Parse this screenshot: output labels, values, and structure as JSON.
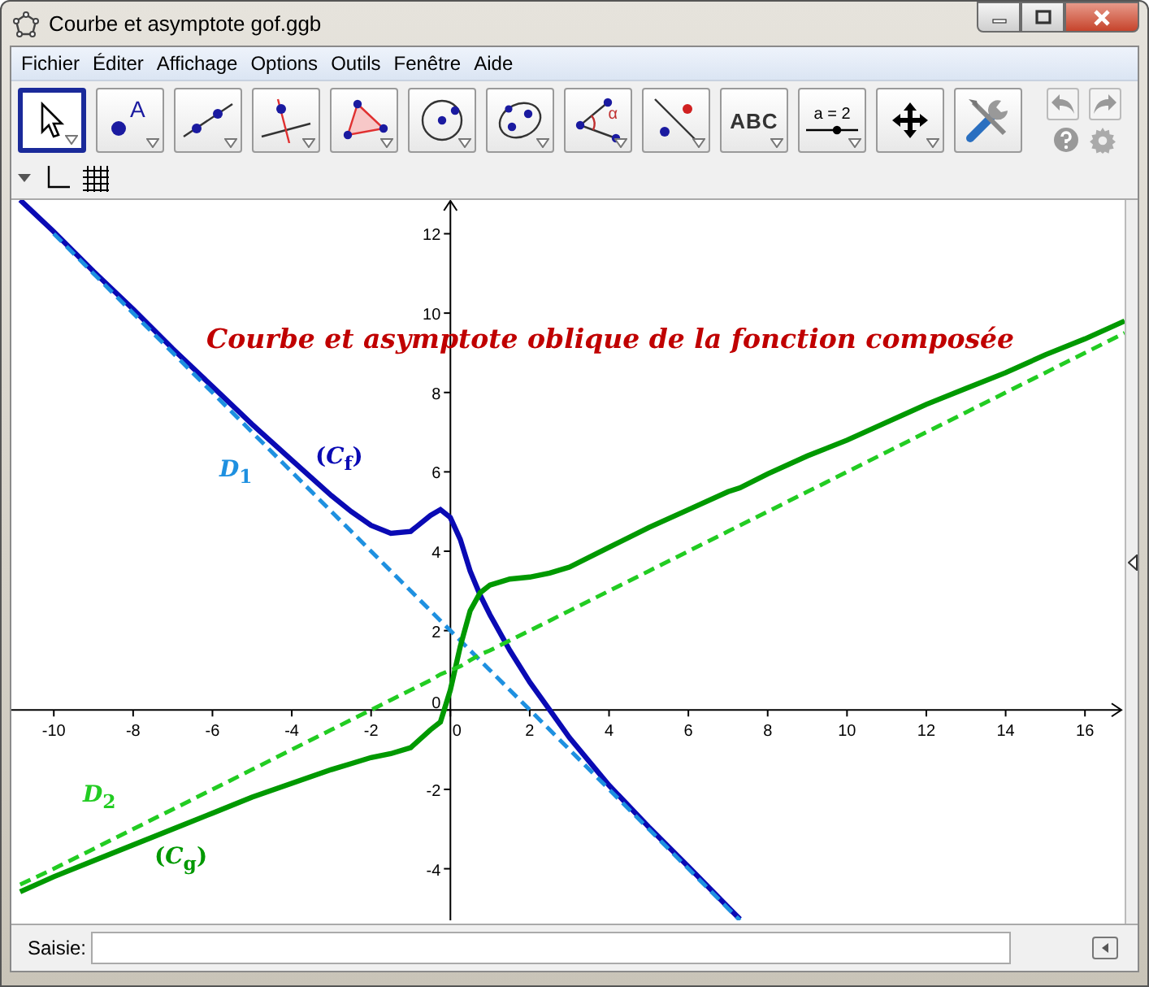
{
  "window": {
    "title": "Courbe et asymptote gof.ggb"
  },
  "menu": [
    "Fichier",
    "Éditer",
    "Affichage",
    "Options",
    "Outils",
    "Fenêtre",
    "Aide"
  ],
  "toolbar": [
    {
      "kind": "move",
      "selected": true
    },
    {
      "kind": "point",
      "label": "A",
      "selected": false
    },
    {
      "kind": "line",
      "selected": false
    },
    {
      "kind": "perpendicular",
      "selected": false
    },
    {
      "kind": "polygon",
      "selected": false
    },
    {
      "kind": "circle",
      "selected": false
    },
    {
      "kind": "conic",
      "selected": false
    },
    {
      "kind": "angle",
      "label": "α",
      "selected": false
    },
    {
      "kind": "reflect",
      "selected": false
    },
    {
      "kind": "text",
      "label": "ABC",
      "selected": false
    },
    {
      "kind": "slider",
      "label": "a = 2",
      "selected": false
    },
    {
      "kind": "pan",
      "selected": false
    },
    {
      "kind": "tools",
      "selected": false
    }
  ],
  "graphics": {
    "chart_data": {
      "type": "line",
      "title": "Courbe et asymptote oblique de la fonction composée",
      "x": [
        -10.85,
        -10,
        -9,
        -8,
        -7,
        -6,
        -5,
        -4,
        -3,
        -2.5,
        -2,
        -1.5,
        -1,
        -0.5,
        -0.25,
        0,
        0.25,
        0.5,
        0.75,
        1,
        1.5,
        2,
        2.5,
        3,
        4,
        5,
        6,
        7,
        7.3,
        8,
        9,
        10,
        11,
        12,
        13,
        14,
        15,
        16,
        17
      ],
      "series": [
        {
          "name": "(*C*$_{f}$)",
          "color": "#0a0ab4",
          "line_style": "solid",
          "values": [
            12.85,
            12.05,
            11.05,
            10.1,
            9.1,
            8.15,
            7.2,
            6.3,
            5.4,
            5.0,
            4.65,
            4.45,
            4.5,
            4.9,
            5.05,
            4.85,
            4.3,
            3.5,
            2.9,
            2.4,
            1.5,
            0.7,
            0,
            -0.7,
            -1.9,
            -2.95,
            -3.95,
            -4.97,
            -5.27,
            null,
            null,
            null,
            null,
            null,
            null,
            null,
            null,
            null,
            null
          ]
        },
        {
          "name": "*D*$_{1}$",
          "color": "#1e90e0",
          "line_style": "dashed",
          "values": [
            null,
            12,
            11,
            10,
            9,
            8,
            7,
            6,
            5,
            4.5,
            4,
            3.5,
            3,
            2.5,
            2.25,
            2,
            1.75,
            1.5,
            1.25,
            1,
            0.5,
            0,
            -0.5,
            -1,
            -2,
            -3,
            -4,
            -5,
            -5.3,
            null,
            null,
            null,
            null,
            null,
            null,
            null,
            null,
            null,
            null
          ]
        },
        {
          "name": "(*C*$_{g}$)",
          "color": "#009900",
          "line_style": "solid",
          "values": [
            -4.58,
            -4.2,
            -3.8,
            -3.4,
            -3.0,
            -2.6,
            -2.2,
            -1.85,
            -1.5,
            -1.35,
            -1.2,
            -1.1,
            -0.95,
            -0.5,
            -0.3,
            0.5,
            1.6,
            2.5,
            2.95,
            3.15,
            3.3,
            3.35,
            3.45,
            3.6,
            4.1,
            4.6,
            5.05,
            5.5,
            5.6,
            5.95,
            6.4,
            6.8,
            7.25,
            7.7,
            8.1,
            8.5,
            8.95,
            9.35,
            9.8
          ]
        },
        {
          "name": "*D*$_{2}$",
          "color": "#22cc22",
          "line_style": "dashed",
          "values": [
            -4.4,
            -4,
            -3.5,
            -3,
            -2.5,
            -2,
            -1.5,
            -1,
            -0.5,
            -0.25,
            0,
            0.25,
            0.5,
            0.75,
            0.9,
            1,
            1.1,
            1.25,
            1.4,
            1.5,
            1.75,
            2,
            2.25,
            2.5,
            3,
            3.5,
            4,
            4.5,
            4.65,
            5,
            5.5,
            6,
            6.5,
            7,
            7.5,
            8,
            8.5,
            9,
            9.5
          ]
        }
      ],
      "xlim": [
        -11.07,
        17.0
      ],
      "ylim": [
        -5.3,
        12.85
      ],
      "xticks": [
        -10,
        -8,
        -6,
        -4,
        -2,
        0,
        2,
        4,
        6,
        8,
        10,
        12,
        14,
        16
      ],
      "yticks": [
        -4,
        -2,
        0,
        2,
        4,
        6,
        8,
        10,
        12
      ]
    }
  },
  "input_bar": {
    "label": "Saisie:"
  }
}
